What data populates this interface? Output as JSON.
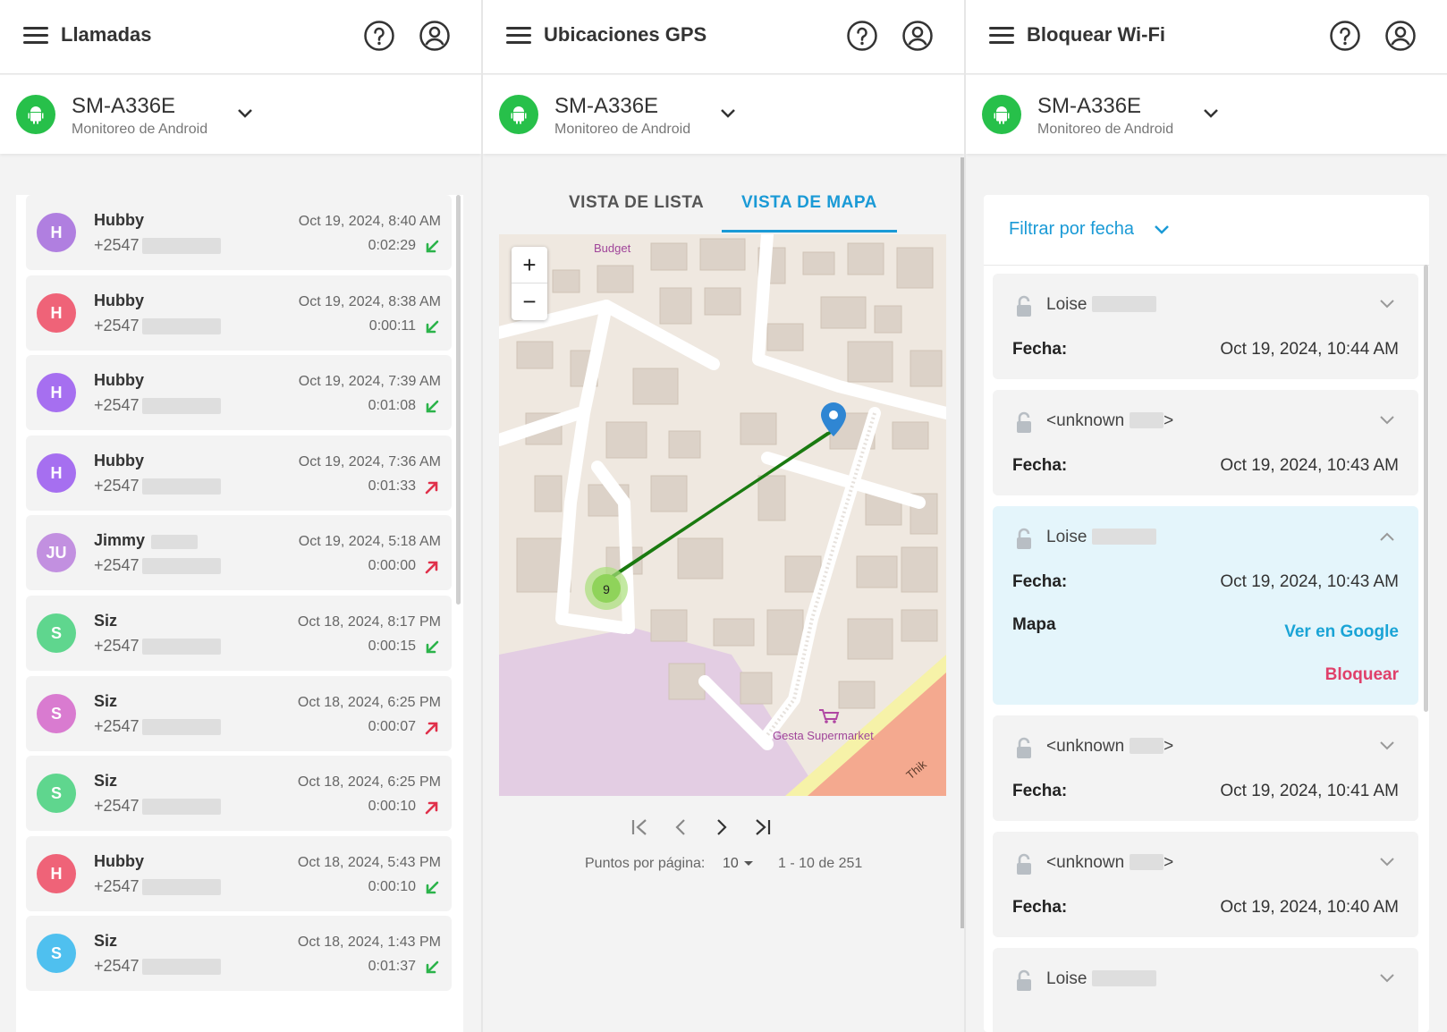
{
  "calls_panel": {
    "title": "Llamadas",
    "device": {
      "name": "SM-A336E",
      "subtitle": "Monitoreo de Android"
    },
    "calls": [
      {
        "initials": "H",
        "name": "Hubby",
        "number": "+2547",
        "date": "Oct 19, 2024, 8:40 AM",
        "duration": "0:02:29",
        "direction": "incoming",
        "avatar_color": "#b07fe0"
      },
      {
        "initials": "H",
        "name": "Hubby",
        "number": "+2547",
        "date": "Oct 19, 2024, 8:38 AM",
        "duration": "0:00:11",
        "direction": "incoming",
        "avatar_color": "#ef6378"
      },
      {
        "initials": "H",
        "name": "Hubby",
        "number": "+2547",
        "date": "Oct 19, 2024, 7:39 AM",
        "duration": "0:01:08",
        "direction": "incoming",
        "avatar_color": "#a66ff0"
      },
      {
        "initials": "H",
        "name": "Hubby",
        "number": "+2547",
        "date": "Oct 19, 2024, 7:36 AM",
        "duration": "0:01:33",
        "direction": "outgoing",
        "avatar_color": "#a66ff0"
      },
      {
        "initials": "JU",
        "name": "Jimmy",
        "number": "+2547",
        "date": "Oct 19, 2024, 5:18 AM",
        "duration": "0:00:00",
        "direction": "outgoing",
        "avatar_color": "#c290e0"
      },
      {
        "initials": "S",
        "name": "Siz",
        "number": "+2547",
        "date": "Oct 18, 2024, 8:17 PM",
        "duration": "0:00:15",
        "direction": "incoming",
        "avatar_color": "#5fd68e"
      },
      {
        "initials": "S",
        "name": "Siz",
        "number": "+2547",
        "date": "Oct 18, 2024, 6:25 PM",
        "duration": "0:00:07",
        "direction": "outgoing",
        "avatar_color": "#d97bd0"
      },
      {
        "initials": "S",
        "name": "Siz",
        "number": "+2547",
        "date": "Oct 18, 2024, 6:25 PM",
        "duration": "0:00:10",
        "direction": "outgoing",
        "avatar_color": "#5fd68e"
      },
      {
        "initials": "H",
        "name": "Hubby",
        "number": "+2547",
        "date": "Oct 18, 2024, 5:43 PM",
        "duration": "0:00:10",
        "direction": "incoming",
        "avatar_color": "#ef6378"
      },
      {
        "initials": "S",
        "name": "Siz",
        "number": "+2547",
        "date": "Oct 18, 2024, 1:43 PM",
        "duration": "0:01:37",
        "direction": "incoming",
        "avatar_color": "#4fc0ef"
      }
    ]
  },
  "gps_panel": {
    "title": "Ubicaciones GPS",
    "device": {
      "name": "SM-A336E",
      "subtitle": "Monitoreo de Android"
    },
    "tabs": [
      {
        "label": "VISTA DE LISTA",
        "active": false
      },
      {
        "label": "VISTA DE MAPA",
        "active": true
      }
    ],
    "map": {
      "zoom_in": "+",
      "zoom_out": "−",
      "cluster_count": "9",
      "labels": {
        "budget": "Budget",
        "supermarket": "Gesta Supermarket",
        "road": "Thik"
      }
    },
    "pagination": {
      "per_page_label": "Puntos por página:",
      "per_page_value": "10",
      "range": "1 - 10 de 251"
    }
  },
  "wifi_panel": {
    "title": "Bloquear Wi-Fi",
    "device": {
      "name": "SM-A336E",
      "subtitle": "Monitoreo de Android"
    },
    "filter_label": "Filtrar por fecha",
    "field_label": "Fecha:",
    "map_label": "Mapa",
    "google_link": "Ver en Google",
    "block_label": "Bloquear",
    "networks": [
      {
        "name": "Loise",
        "date": "Oct 19, 2024, 10:44 AM",
        "expanded": false
      },
      {
        "name": "<unknown",
        "suffix": ">",
        "date": "Oct 19, 2024, 10:43 AM",
        "expanded": false
      },
      {
        "name": "Loise",
        "date": "Oct 19, 2024, 10:43 AM",
        "expanded": true
      },
      {
        "name": "<unknown",
        "suffix": ">",
        "date": "Oct 19, 2024, 10:41 AM",
        "expanded": false
      },
      {
        "name": "<unknown",
        "suffix": ">",
        "date": "Oct 19, 2024, 10:40 AM",
        "expanded": false
      },
      {
        "name": "Loise",
        "date": "",
        "expanded": false
      }
    ]
  },
  "colors": {
    "accent": "#1a9ad6",
    "android_green": "#27c04a",
    "incoming": "#2bb34a",
    "outgoing": "#e0304a",
    "track": "#1a7a10",
    "block": "#e0406a"
  }
}
